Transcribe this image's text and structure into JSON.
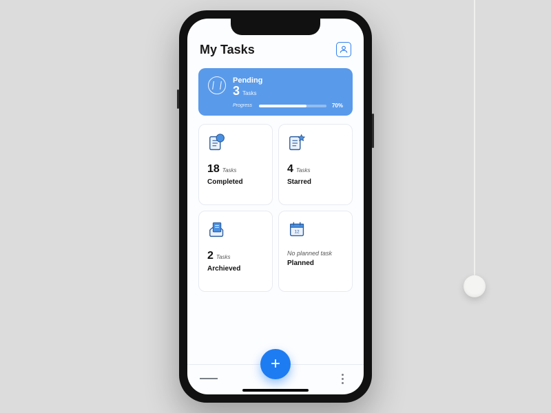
{
  "header": {
    "title": "My Tasks"
  },
  "pending": {
    "label": "Pending",
    "count": "3",
    "unit": "Tasks",
    "progress_label": "Progress",
    "progress_pct": "70%",
    "progress_value": 70
  },
  "tiles": {
    "completed": {
      "count": "18",
      "unit": "Tasks",
      "title": "Completed"
    },
    "starred": {
      "count": "4",
      "unit": "Tasks",
      "title": "Starred"
    },
    "archived": {
      "count": "2",
      "unit": "Tasks",
      "title": "Archieved"
    },
    "planned": {
      "empty": "No planned task",
      "title": "Planned"
    }
  },
  "colors": {
    "accent": "#1e7cf2",
    "card": "#5a9aea"
  }
}
